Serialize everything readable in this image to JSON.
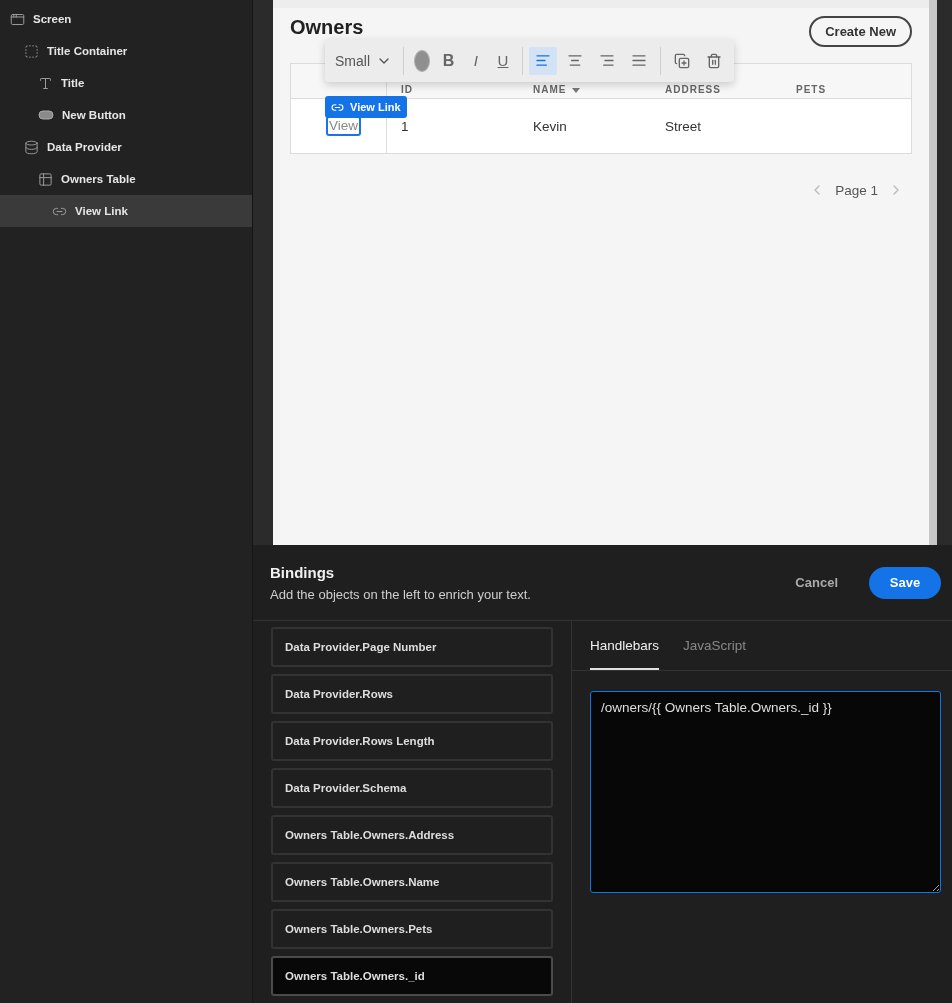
{
  "sidebar": {
    "items": [
      {
        "label": "Screen",
        "kind": "screen",
        "selected": false,
        "children": [
          {
            "label": "Title Container",
            "kind": "container",
            "selected": false,
            "children": [
              {
                "label": "Title",
                "kind": "text",
                "selected": false
              },
              {
                "label": "New Button",
                "kind": "button",
                "selected": false
              }
            ]
          },
          {
            "label": "Data Provider",
            "kind": "provider",
            "selected": false,
            "children": [
              {
                "label": "Owners Table",
                "kind": "table",
                "selected": false,
                "children": [
                  {
                    "label": "View Link",
                    "kind": "link",
                    "selected": true
                  }
                ]
              }
            ]
          }
        ]
      }
    ]
  },
  "preview": {
    "title": "Owners",
    "create_button": "Create New",
    "toolbar": {
      "size": "Small",
      "styles": [
        {
          "kind": "bold",
          "label": "B"
        },
        {
          "kind": "italic",
          "label": "I"
        },
        {
          "kind": "underline",
          "label": "U"
        }
      ],
      "aligns": [
        {
          "kind": "left",
          "selected": true
        },
        {
          "kind": "center",
          "selected": false
        },
        {
          "kind": "right",
          "selected": false
        },
        {
          "kind": "justify",
          "selected": false
        }
      ]
    },
    "selection_tag": "View Link",
    "table": {
      "columns": [
        {
          "label": "ID",
          "sorted": false
        },
        {
          "label": "NAME",
          "sorted": true
        },
        {
          "label": "ADDRESS",
          "sorted": false
        },
        {
          "label": "PETS",
          "sorted": false
        }
      ],
      "rows": [
        {
          "link": "View",
          "cells": [
            "1",
            "Kevin",
            "Street"
          ]
        }
      ]
    },
    "pagination": "Page 1"
  },
  "bindings": {
    "title": "Bindings",
    "subtitle": "Add the objects on the left to enrich your text.",
    "cancel": "Cancel",
    "save": "Save",
    "items": [
      {
        "label": "Data Provider.Page Number",
        "selected": false
      },
      {
        "label": "Data Provider.Rows",
        "selected": false
      },
      {
        "label": "Data Provider.Rows Length",
        "selected": false
      },
      {
        "label": "Data Provider.Schema",
        "selected": false
      },
      {
        "label": "Owners Table.Owners.Address",
        "selected": false
      },
      {
        "label": "Owners Table.Owners.Name",
        "selected": false
      },
      {
        "label": "Owners Table.Owners.Pets",
        "selected": false
      },
      {
        "label": "Owners Table.Owners._id",
        "selected": true
      }
    ],
    "tabs": [
      {
        "label": "Handlebars",
        "selected": true
      },
      {
        "label": "JavaScript",
        "selected": false
      }
    ],
    "value": "/owners/{{ Owners Table.Owners._id }}"
  }
}
